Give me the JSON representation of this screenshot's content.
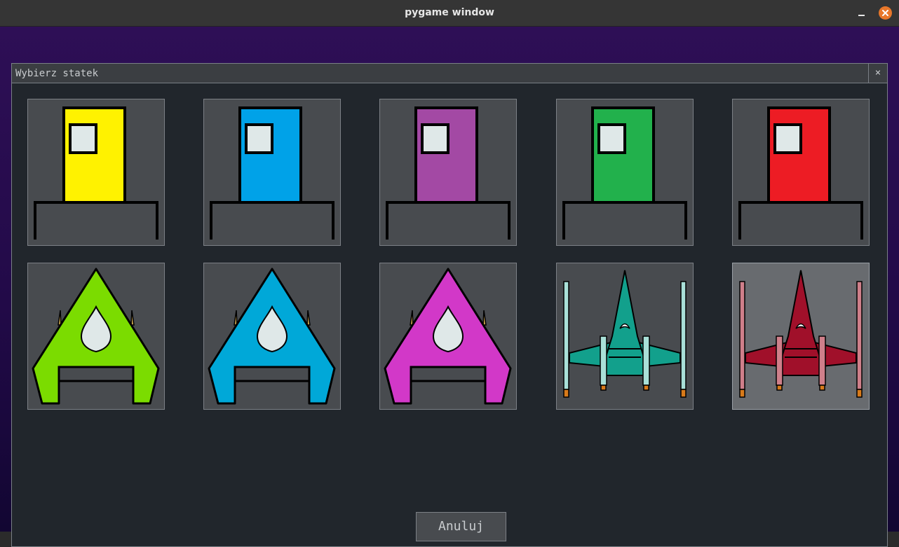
{
  "window": {
    "title": "pygame window"
  },
  "dialog": {
    "title": "Wybierz statek",
    "close_label": "×",
    "cancel_label": "Anuluj"
  },
  "ships": [
    {
      "type": "house",
      "color": "#fff200",
      "selected": false
    },
    {
      "type": "house",
      "color": "#00a2e8",
      "selected": false
    },
    {
      "type": "house",
      "color": "#a349a4",
      "selected": false
    },
    {
      "type": "house",
      "color": "#22b14c",
      "selected": false
    },
    {
      "type": "house",
      "color": "#ed1c24",
      "selected": false
    },
    {
      "type": "delta",
      "color": "#7bdc00",
      "selected": false
    },
    {
      "type": "delta",
      "color": "#00a8d8",
      "selected": false
    },
    {
      "type": "delta",
      "color": "#d238c8",
      "selected": false
    },
    {
      "type": "fighter",
      "color": "#12a08c",
      "accent": "#a9e0d8",
      "selected": false
    },
    {
      "type": "fighter",
      "color": "#a0102a",
      "accent": "#cf7f8a",
      "selected": true
    }
  ]
}
